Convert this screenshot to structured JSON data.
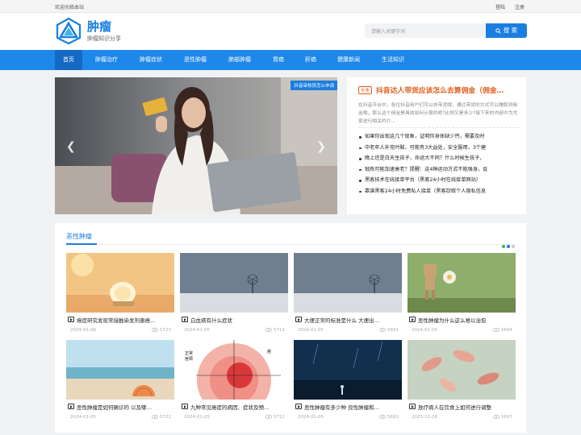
{
  "topbar": {
    "welcome": "欢迎光临本站",
    "login": "登陆",
    "register": "注册"
  },
  "header": {
    "site_name": "肿瘤",
    "site_sub": "肿瘤知识分享",
    "search_placeholder": "请输入关键字词",
    "search_button": "搜 索"
  },
  "nav": [
    {
      "label": "首页",
      "active": true
    },
    {
      "label": "肿瘤治疗"
    },
    {
      "label": "肿瘤症状"
    },
    {
      "label": "恶性肿瘤"
    },
    {
      "label": "肺部肿瘤"
    },
    {
      "label": "胃癌"
    },
    {
      "label": "肝癌"
    },
    {
      "label": "健康新闻"
    },
    {
      "label": "生活知识"
    }
  ],
  "slider": {
    "tag": "抖音审核员怎么申请"
  },
  "headline": {
    "badge": "头条",
    "title": "抖音达人带货应该怎么去算佣金（佣金…",
    "desc": "在抖音平台中，各位抖音用户们可以去带货哦，通过带货的方式可以赚取到佣金哦，那么这个佣金是具体如何计算的呢?比例又是多少?接下来的内容中为大家进行相关的介...",
    "items": [
      "如果你出现这几个现象，证明你身体缺少钙，需要及时",
      "中老年人补充叶酸，可能有3大益处，安全服用，3个建",
      "晚上还是白天生孩子，命运大不同？什么时候生孩子，",
      "锻炼可能加速衰老？提醒：这4种运动方式不能强身，反",
      "黑客技术在线接单平台（黑客24小时在线接单网站）",
      "靠谱黑客24小时免费私人接单（黑客窃取个人隐私信息"
    ]
  },
  "section": {
    "title": "恶性肿瘤",
    "cards": [
      {
        "title": "癌症研究发现常接触染发剂患癌…",
        "date": "2024-01-06",
        "views": "5727"
      },
      {
        "title": "白血病有什么症状",
        "date": "2024-01-05",
        "views": "5711"
      },
      {
        "title": "大便正常的标准是什么 大便出…",
        "date": "2024-01-05",
        "views": "5691"
      },
      {
        "title": "恶性肿瘤为什么这么难以治愈",
        "date": "2024-01-05",
        "views": "5694"
      },
      {
        "title": "恶性肿瘤是如何确诊的 以及哪…",
        "date": "2024-01-05",
        "views": "5722"
      },
      {
        "title": "九种常见癌症的病因、症状及预…",
        "date": "2024-01-05",
        "views": "5712"
      },
      {
        "title": "恶性肿瘤有多少种 良性肿瘤和…",
        "date": "2024-01-05",
        "views": "5693"
      },
      {
        "title": "放疗病人在饮食上如何进行调整",
        "date": "2023-12-26",
        "views": "5697"
      }
    ],
    "diagram_labels": {
      "left_top": "正常",
      "left_bottom": "宫颈",
      "right": "癌"
    }
  },
  "colors": {
    "brand": "#1e88ea",
    "nav_active": "#1469c2",
    "headline": "#e25c17"
  }
}
